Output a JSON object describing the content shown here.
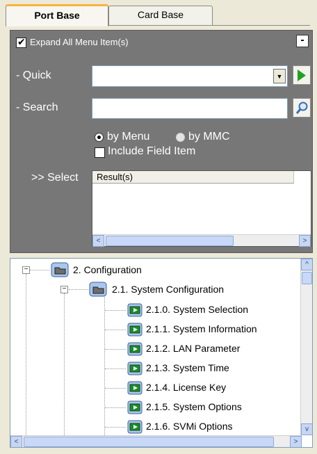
{
  "tabs": [
    {
      "label": "Port Base",
      "active": true
    },
    {
      "label": "Card Base",
      "active": false
    }
  ],
  "panel": {
    "expand_all": {
      "label": "Expand All Menu Item(s)",
      "checked": true
    },
    "collapse_label": "-",
    "quick_label": "- Quick",
    "quick_value": "",
    "search_label": "- Search",
    "search_value": "",
    "by_menu": {
      "label": "by Menu",
      "selected": true
    },
    "by_mmc": {
      "label": "by MMC",
      "selected": false
    },
    "include_field": {
      "label": "Include Field Item",
      "checked": false
    },
    "select_label": ">> Select",
    "result_header": "Result(s)"
  },
  "tree": {
    "items": [
      {
        "label": "2. Configuration",
        "level": 0,
        "type": "folder",
        "expanded": true
      },
      {
        "label": "2.1. System Configuration",
        "level": 1,
        "type": "folder",
        "expanded": true
      },
      {
        "label": "2.1.0. System Selection",
        "level": 2,
        "type": "leaf"
      },
      {
        "label": "2.1.1. System Information",
        "level": 2,
        "type": "leaf"
      },
      {
        "label": "2.1.2. LAN Parameter",
        "level": 2,
        "type": "leaf"
      },
      {
        "label": "2.1.3. System Time",
        "level": 2,
        "type": "leaf"
      },
      {
        "label": "2.1.4. License Key",
        "level": 2,
        "type": "leaf"
      },
      {
        "label": "2.1.5. System Options",
        "level": 2,
        "type": "leaf"
      },
      {
        "label": "2.1.6. SVMi Options",
        "level": 2,
        "type": "leaf"
      }
    ]
  },
  "colors": {
    "panel_bg": "#777777",
    "tab_accent": "#f7b33c",
    "go_arrow": "#22a022"
  }
}
